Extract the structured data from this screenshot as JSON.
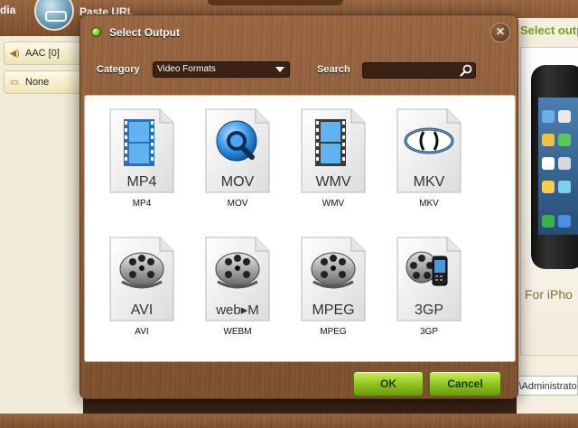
{
  "app": {
    "toolbar": {
      "media_label": "dia",
      "paste_url_label": "Paste URL"
    },
    "left_panel": {
      "audio_track": {
        "label": "AAC [0]",
        "icon": "speaker-icon"
      },
      "subtitle": {
        "label": "None",
        "icon": "subtitle-icon"
      }
    },
    "right_panel": {
      "header": "Select outp",
      "device_caption": "For iPho",
      "path_text": "s\\Administrator"
    }
  },
  "dialog": {
    "title": "Select Output",
    "close_glyph": "✕",
    "category": {
      "label": "Category",
      "value": "Video Formats"
    },
    "search": {
      "label": "Search",
      "value": "",
      "placeholder": ""
    },
    "formats": [
      {
        "file_label": "MP4",
        "caption": "MP4",
        "icon": "film-strip-icon"
      },
      {
        "file_label": "MOV",
        "caption": "MOV",
        "icon": "quicktime-icon"
      },
      {
        "file_label": "WMV",
        "caption": "WMV",
        "icon": "film-strip-icon"
      },
      {
        "file_label": "MKV",
        "caption": "MKV",
        "icon": "matroska-icon"
      },
      {
        "file_label": "AVI",
        "caption": "AVI",
        "icon": "film-reel-icon"
      },
      {
        "file_label": "web▸M",
        "caption": "WEBM",
        "icon": "film-reel-icon"
      },
      {
        "file_label": "MPEG",
        "caption": "MPEG",
        "icon": "film-reel-icon"
      },
      {
        "file_label": "3GP",
        "caption": "3GP",
        "icon": "reel-phone-icon"
      }
    ],
    "buttons": {
      "ok": "OK",
      "cancel": "Cancel"
    }
  },
  "colors": {
    "wood": "#8b5a36",
    "accent_green": "#8cc21d",
    "header_green": "#6fa323",
    "film_blue": "#3b8fd8"
  }
}
